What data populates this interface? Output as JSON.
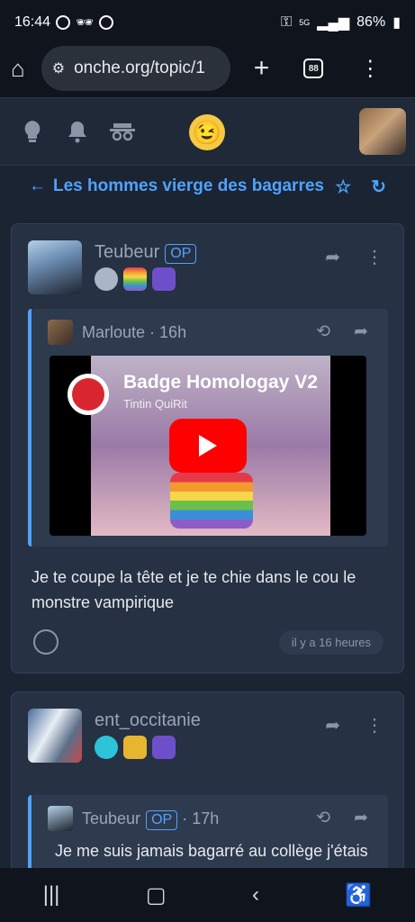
{
  "status": {
    "time": "16:44",
    "battery": "86%",
    "network": "5G"
  },
  "browser": {
    "url": "onche.org/topic/1",
    "tab_count": "88"
  },
  "topic": {
    "back_arrow": "←",
    "title": "Les hommes vierge des bagarres"
  },
  "post1": {
    "username": "Teubeur",
    "op_label": "OP",
    "quote": {
      "username": "Marloute",
      "time": "· 16h",
      "video_title": "Badge Homologay V2",
      "video_channel": "Tintin QuiRit"
    },
    "text": "Je te coupe la tête et je te chie dans le cou le monstre vampirique",
    "timestamp": "il y a 16 heures"
  },
  "post2": {
    "username": "ent_occitanie",
    "quote": {
      "username": "Teubeur",
      "op_label": "OP",
      "time": "· 17h",
      "text": "Je me suis jamais bagarré au collège j'étais protégé par une grosse racaille"
    }
  },
  "colors": {
    "accent": "#4fa3ff",
    "background": "#1b2433",
    "card": "#263143"
  }
}
